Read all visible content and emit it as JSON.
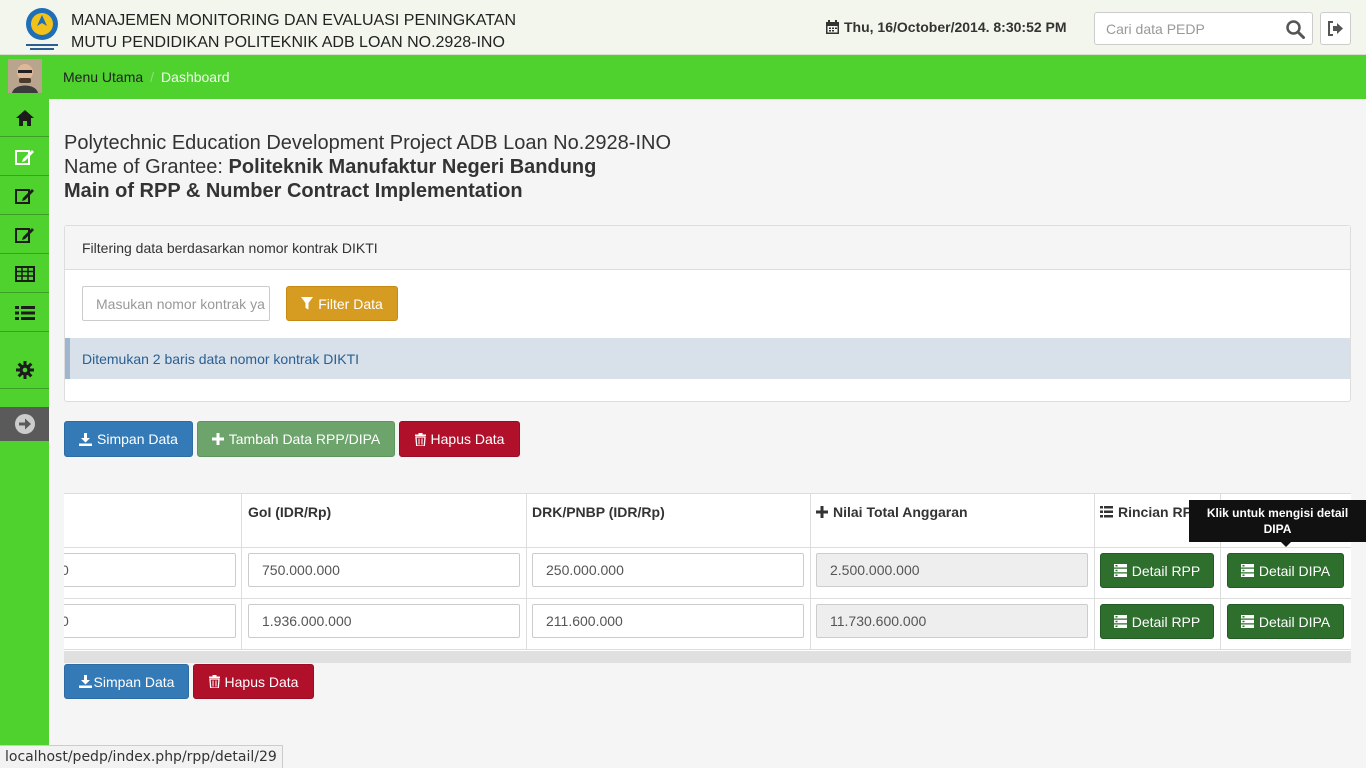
{
  "header": {
    "title_line1": "MANAJEMEN MONITORING DAN EVALUASI PENINGKATAN",
    "title_line2": "MUTU PENDIDIKAN POLITEKNIK ADB LOAN NO.2928-INO",
    "datetime": "Thu, 16/October/2014. 8:30:52 PM",
    "search_placeholder": "Cari data PEDP"
  },
  "breadcrumb": {
    "home": "Menu Utama",
    "separator": "/",
    "current": "Dashboard"
  },
  "sidebar": {
    "items": [
      "home-icon",
      "edit-icon",
      "edit-icon",
      "edit-icon",
      "table-icon",
      "list-icon",
      "gear-icon",
      "arrow-right-icon"
    ]
  },
  "heading": {
    "line1": "Polytechnic Education Development Project ADB Loan No.2928-INO",
    "grantee_label": "Name of Grantee: ",
    "grantee_name": "Politeknik Manufaktur Negeri Bandung",
    "line3": "Main of RPP & Number Contract Implementation"
  },
  "filter_panel": {
    "title": "Filtering data berdasarkan nomor kontrak DIKTI",
    "input_placeholder": "Masukan nomor kontrak ya",
    "filter_button": "Filter Data",
    "info": "Ditemukan 2 baris data nomor kontrak DIKTI"
  },
  "actions_top": {
    "save": "Simpan Data",
    "add": "Tambah Data RPP/DIPA",
    "delete": "Hapus Data"
  },
  "table": {
    "headers": {
      "goi": "GoI (IDR/Rp)",
      "drk": "DRK/PNBP (IDR/Rp)",
      "total": "Nilai Total Anggaran",
      "rincian": "Rincian RPP"
    },
    "rows": [
      {
        "first": "0",
        "goi": "750.000.000",
        "drk": "250.000.000",
        "total": "2.500.000.000",
        "rpp_button": "Detail RPP",
        "dipa_button": "Detail DIPA"
      },
      {
        "first": "0",
        "goi": "1.936.000.000",
        "drk": "211.600.000",
        "total": "11.730.600.000",
        "rpp_button": "Detail RPP",
        "dipa_button": "Detail DIPA"
      }
    ],
    "tooltip": "Klik untuk mengisi detail DIPA"
  },
  "actions_bottom": {
    "save": "Simpan Data",
    "delete": "Hapus Data"
  },
  "status_bar": {
    "url": "localhost/pedp/index.php/rpp/detail/29"
  }
}
